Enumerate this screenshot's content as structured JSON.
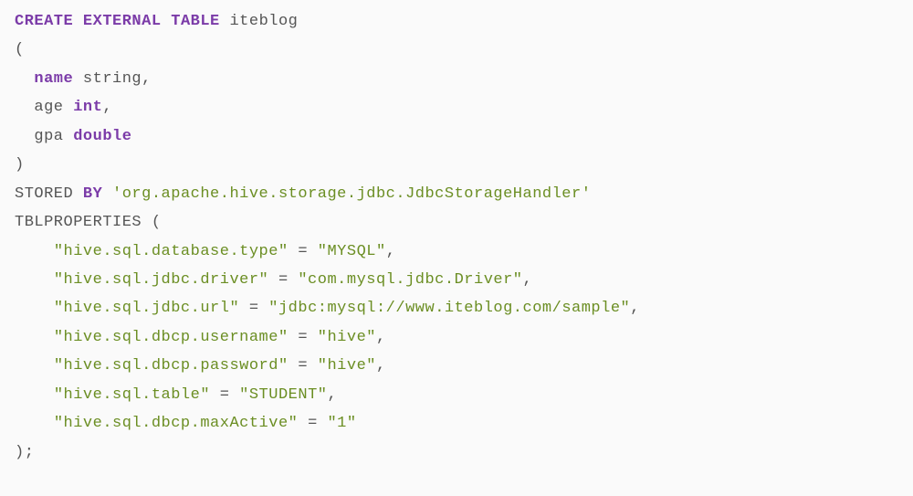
{
  "code": {
    "line1": {
      "kw_create": "CREATE",
      "kw_external": "EXTERNAL",
      "kw_table": "TABLE",
      "tablename": "iteblog"
    },
    "line2": {
      "paren": "("
    },
    "line3": {
      "colname": "name",
      "coltype": "string",
      "comma": ","
    },
    "line4": {
      "colname": "age",
      "coltype": "int",
      "comma": ","
    },
    "line5": {
      "colname": "gpa",
      "coltype": "double"
    },
    "line6": {
      "paren": ")"
    },
    "line7": {
      "stored": "STORED",
      "by": "BY",
      "handler": "'org.apache.hive.storage.jdbc.JdbcStorageHandler'"
    },
    "line8": {
      "tblprops": "TBLPROPERTIES",
      "paren": "("
    },
    "line9": {
      "key": "\"hive.sql.database.type\"",
      "eq": "=",
      "val": "\"MYSQL\"",
      "comma": ","
    },
    "line10": {
      "key": "\"hive.sql.jdbc.driver\"",
      "eq": "=",
      "val": "\"com.mysql.jdbc.Driver\"",
      "comma": ","
    },
    "line11": {
      "key": "\"hive.sql.jdbc.url\"",
      "eq": "=",
      "val": "\"jdbc:mysql://www.iteblog.com/sample\"",
      "comma": ","
    },
    "line12": {
      "key": "\"hive.sql.dbcp.username\"",
      "eq": "=",
      "val": "\"hive\"",
      "comma": ","
    },
    "line13": {
      "key": "\"hive.sql.dbcp.password\"",
      "eq": "=",
      "val": "\"hive\"",
      "comma": ","
    },
    "line14": {
      "key": "\"hive.sql.table\"",
      "eq": "=",
      "val": "\"STUDENT\"",
      "comma": ","
    },
    "line15": {
      "key": "\"hive.sql.dbcp.maxActive\"",
      "eq": "=",
      "val": "\"1\""
    },
    "line16": {
      "paren": ")",
      "semi": ";"
    }
  }
}
